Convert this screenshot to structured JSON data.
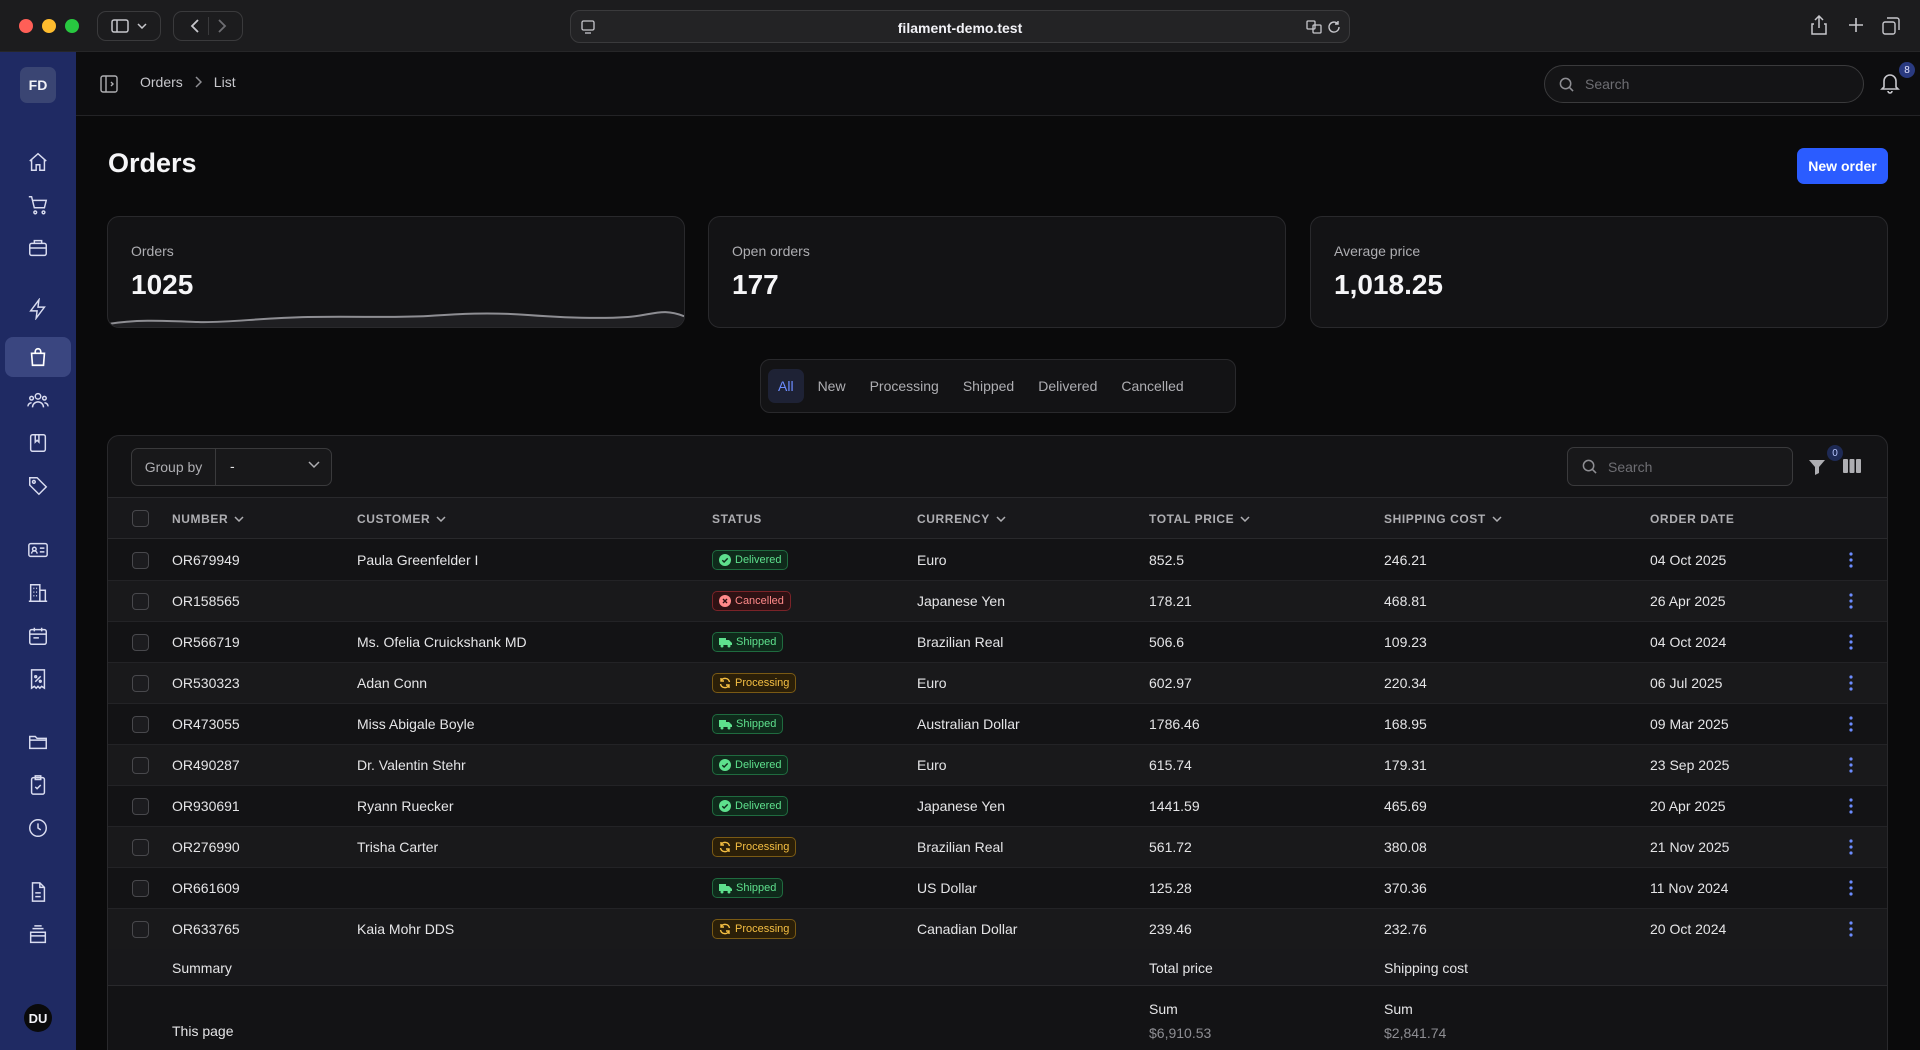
{
  "browser": {
    "url": "filament-demo.test"
  },
  "sidebar": {
    "logo": "FD",
    "user_initials": "DU",
    "items": [
      {
        "icon": "home-icon"
      },
      {
        "icon": "cart-icon"
      },
      {
        "icon": "briefcase-icon"
      },
      {
        "icon": "bolt-icon"
      },
      {
        "icon": "shopping-bag-icon",
        "active": true
      },
      {
        "icon": "users-icon"
      },
      {
        "icon": "book-icon"
      },
      {
        "icon": "tag-icon"
      },
      {
        "icon": "id-card-icon"
      },
      {
        "icon": "building-icon"
      },
      {
        "icon": "calendar-icon"
      },
      {
        "icon": "receipt-percent-icon"
      },
      {
        "icon": "folder-icon"
      },
      {
        "icon": "clipboard-check-icon"
      },
      {
        "icon": "clock-icon"
      },
      {
        "icon": "document-icon"
      },
      {
        "icon": "archive-icon"
      }
    ]
  },
  "topbar": {
    "breadcrumb": [
      "Orders",
      "List"
    ],
    "search_placeholder": "Search",
    "notification_count": "8"
  },
  "page": {
    "title": "Orders",
    "new_button": "New order"
  },
  "stats": [
    {
      "label": "Orders",
      "value": "1025"
    },
    {
      "label": "Open orders",
      "value": "177"
    },
    {
      "label": "Average price",
      "value": "1,018.25"
    }
  ],
  "tabs": [
    "All",
    "New",
    "Processing",
    "Shipped",
    "Delivered",
    "Cancelled"
  ],
  "active_tab": "All",
  "table": {
    "group_by_label": "Group by",
    "group_by_value": "-",
    "search_placeholder": "Search",
    "filter_count": "0",
    "columns": [
      "NUMBER",
      "CUSTOMER",
      "STATUS",
      "CURRENCY",
      "TOTAL PRICE",
      "SHIPPING COST",
      "ORDER DATE"
    ],
    "rows": [
      {
        "number": "OR679949",
        "customer": "Paula Greenfelder I",
        "status": "Delivered",
        "currency": "Euro",
        "total": "852.5",
        "shipping": "246.21",
        "date": "04 Oct 2025"
      },
      {
        "number": "OR158565",
        "customer": "",
        "status": "Cancelled",
        "currency": "Japanese Yen",
        "total": "178.21",
        "shipping": "468.81",
        "date": "26 Apr 2025"
      },
      {
        "number": "OR566719",
        "customer": "Ms. Ofelia Cruickshank MD",
        "status": "Shipped",
        "currency": "Brazilian Real",
        "total": "506.6",
        "shipping": "109.23",
        "date": "04 Oct 2024"
      },
      {
        "number": "OR530323",
        "customer": "Adan Conn",
        "status": "Processing",
        "currency": "Euro",
        "total": "602.97",
        "shipping": "220.34",
        "date": "06 Jul 2025"
      },
      {
        "number": "OR473055",
        "customer": "Miss Abigale Boyle",
        "status": "Shipped",
        "currency": "Australian Dollar",
        "total": "1786.46",
        "shipping": "168.95",
        "date": "09 Mar 2025"
      },
      {
        "number": "OR490287",
        "customer": "Dr. Valentin Stehr",
        "status": "Delivered",
        "currency": "Euro",
        "total": "615.74",
        "shipping": "179.31",
        "date": "23 Sep 2025"
      },
      {
        "number": "OR930691",
        "customer": "Ryann Ruecker",
        "status": "Delivered",
        "currency": "Japanese Yen",
        "total": "1441.59",
        "shipping": "465.69",
        "date": "20 Apr 2025"
      },
      {
        "number": "OR276990",
        "customer": "Trisha Carter",
        "status": "Processing",
        "currency": "Brazilian Real",
        "total": "561.72",
        "shipping": "380.08",
        "date": "21 Nov 2025"
      },
      {
        "number": "OR661609",
        "customer": "",
        "status": "Shipped",
        "currency": "US Dollar",
        "total": "125.28",
        "shipping": "370.36",
        "date": "11 Nov 2024"
      },
      {
        "number": "OR633765",
        "customer": "Kaia Mohr DDS",
        "status": "Processing",
        "currency": "Canadian Dollar",
        "total": "239.46",
        "shipping": "232.76",
        "date": "20 Oct 2024"
      }
    ],
    "summary": {
      "label": "Summary",
      "total_label": "Total price",
      "shipping_label": "Shipping cost",
      "page_label": "This page",
      "sum_label": "Sum",
      "total_sum": "$6,910.53",
      "shipping_sum": "$2,841.74"
    }
  },
  "colors": {
    "sidebar": "#1f2a63",
    "accent": "#2b5cff",
    "delivered": "#5ee08d",
    "cancelled": "#ff8a8a",
    "processing": "#f5bf43"
  }
}
